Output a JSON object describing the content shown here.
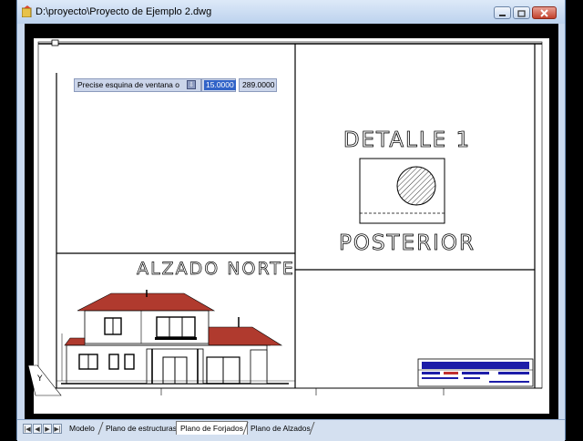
{
  "window": {
    "title": "D:\\proyecto\\Proyecto de Ejemplo 2.dwg"
  },
  "command_line": {
    "prompt": "Precise esquina de ventana o",
    "dropdown_glyph": "⇩",
    "value_x": "15.0000",
    "value_y": "289.0000"
  },
  "drawing": {
    "detail_title": "DETALLE 1",
    "detail_subtitle": "POSTERIOR",
    "elevation_title": "ALZADO NORTE",
    "ucs_label": "Y"
  },
  "layout_tabs": {
    "nav_buttons": [
      "|◀",
      "◀",
      "▶",
      "▶|"
    ],
    "tabs": [
      {
        "label": "Modelo",
        "active": false
      },
      {
        "label": "Plano de estructuras",
        "active": false
      },
      {
        "label": "Plano de Forjados",
        "active": true
      },
      {
        "label": "Plano de Alzados",
        "active": false
      }
    ]
  },
  "colors": {
    "paper": "#ffffff",
    "background": "#000000",
    "roof": "#b03a2e",
    "titlebar": "#c9d9ef",
    "selection": "#3163c8"
  }
}
